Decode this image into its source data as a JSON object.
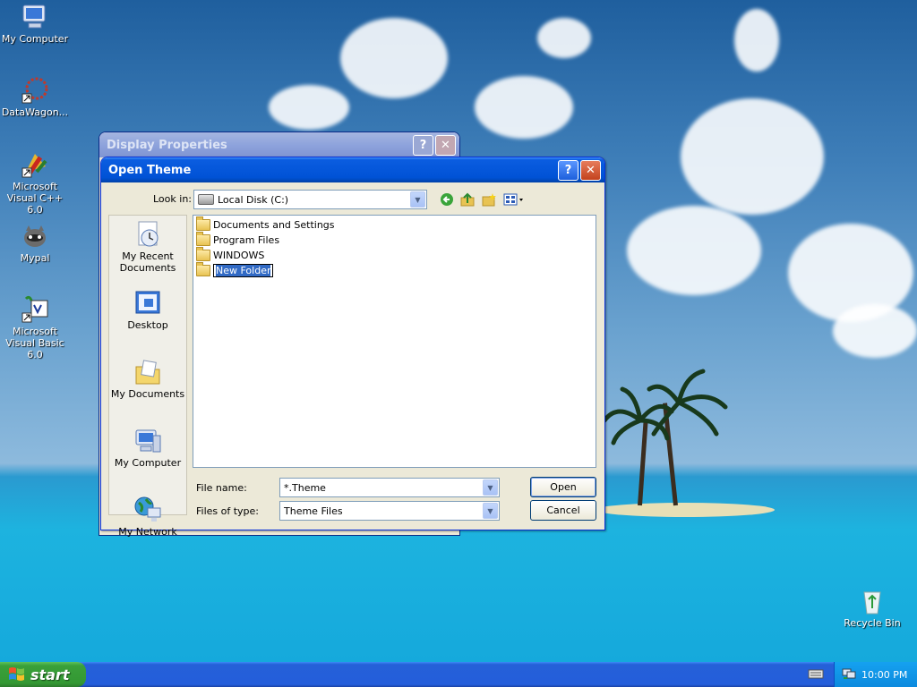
{
  "desktop": {
    "icons": [
      {
        "label": "My Computer",
        "icon": "my-computer-icon"
      },
      {
        "label": "DataWagon...",
        "icon": "datawagon-icon"
      },
      {
        "label": "Microsoft Visual C++ 6.0",
        "icon": "visual-cpp-icon"
      },
      {
        "label": "Mypal",
        "icon": "mypal-icon"
      },
      {
        "label": "Microsoft Visual Basic 6.0",
        "icon": "visual-basic-icon"
      },
      {
        "label": "Recycle Bin",
        "icon": "recycle-bin-icon"
      }
    ]
  },
  "display_properties": {
    "title": "Display Properties",
    "help": "?",
    "close": "✕"
  },
  "open_theme": {
    "title": "Open Theme",
    "help": "?",
    "close": "✕",
    "look_in_label": "Look in:",
    "look_in_value": "Local Disk (C:)",
    "places": [
      {
        "label": "My Recent Documents",
        "icon": "recent-documents-icon"
      },
      {
        "label": "Desktop",
        "icon": "desktop-icon"
      },
      {
        "label": "My Documents",
        "icon": "my-documents-icon"
      },
      {
        "label": "My Computer",
        "icon": "my-computer-icon"
      },
      {
        "label": "My Network",
        "icon": "my-network-icon"
      }
    ],
    "files": [
      {
        "name": "Documents and Settings"
      },
      {
        "name": "Program Files"
      },
      {
        "name": "WINDOWS"
      },
      {
        "name": "New Folder",
        "renaming": true
      }
    ],
    "file_name_label": "File name:",
    "file_name_value": "*.Theme",
    "files_of_type_label": "Files of type:",
    "files_of_type_value": "Theme Files",
    "open_label": "Open",
    "cancel_label": "Cancel"
  },
  "taskbar": {
    "start_label": "start",
    "clock": "10:00 PM"
  },
  "colors": {
    "xp_blue": "#0052d6",
    "start_green": "#339833",
    "dialog_bg": "#ece9d8"
  }
}
